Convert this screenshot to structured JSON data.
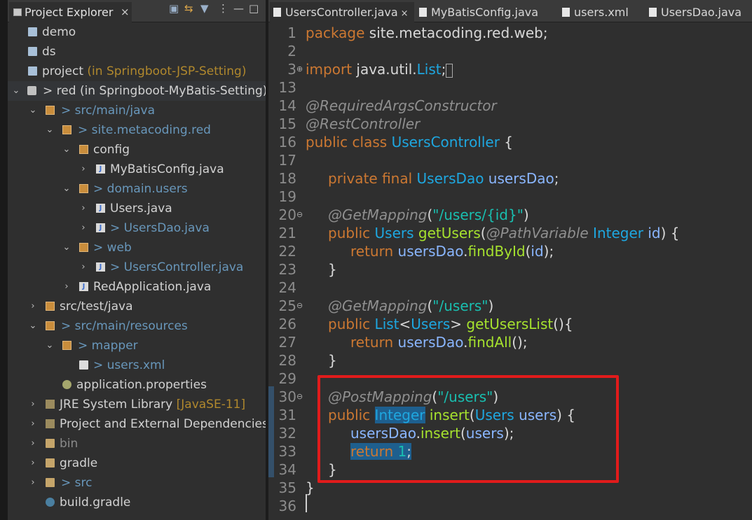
{
  "explorer": {
    "tab_label": "Project Explorer",
    "close": "×",
    "items": [
      {
        "label": "demo"
      },
      {
        "label": "ds"
      },
      {
        "label": "project",
        "suffix": "(in Springboot-JSP-Setting)"
      },
      {
        "prefix": ">",
        "label": "red",
        "suffix": "(in Springboot-MyBatis-Setting)"
      },
      {
        "prefix": ">",
        "label": "src/main/java"
      },
      {
        "prefix": ">",
        "label": "site.metacoding.red"
      },
      {
        "label": "config"
      },
      {
        "label": "MyBatisConfig.java"
      },
      {
        "prefix": ">",
        "label": "domain.users"
      },
      {
        "label": "Users.java"
      },
      {
        "prefix": ">",
        "label": "UsersDao.java"
      },
      {
        "prefix": ">",
        "label": "web"
      },
      {
        "prefix": ">",
        "label": "UsersController.java"
      },
      {
        "label": "RedApplication.java"
      },
      {
        "label": "src/test/java"
      },
      {
        "prefix": ">",
        "label": "src/main/resources"
      },
      {
        "prefix": ">",
        "label": "mapper"
      },
      {
        "prefix": ">",
        "label": "users.xml"
      },
      {
        "label": "application.properties"
      },
      {
        "label": "JRE System Library",
        "suffix": "[JavaSE-11]"
      },
      {
        "label": "Project and External Dependencies"
      },
      {
        "label": "bin"
      },
      {
        "label": "gradle"
      },
      {
        "prefix": ">",
        "label": "src"
      },
      {
        "label": "build.gradle"
      }
    ]
  },
  "editor": {
    "tabs": [
      {
        "label": "UsersController.java",
        "close": "×"
      },
      {
        "label": "MyBatisConfig.java"
      },
      {
        "label": "users.xml"
      },
      {
        "label": "UsersDao.java"
      }
    ],
    "lines": [
      {
        "n": "1",
        "text": "package site.metacoding.red.web;"
      },
      {
        "n": "2",
        "text": ""
      },
      {
        "n": "3",
        "text": "import java.util.List;"
      },
      {
        "n": "13",
        "text": ""
      },
      {
        "n": "14",
        "text": "@RequiredArgsConstructor"
      },
      {
        "n": "15",
        "text": "@RestController"
      },
      {
        "n": "16",
        "text": "public class UsersController {"
      },
      {
        "n": "17",
        "text": ""
      },
      {
        "n": "18",
        "text": "private final UsersDao usersDao;"
      },
      {
        "n": "19",
        "text": ""
      },
      {
        "n": "20",
        "text": "@GetMapping(\"/users/{id}\")"
      },
      {
        "n": "21",
        "text": "public Users getUsers(@PathVariable Integer id) {"
      },
      {
        "n": "22",
        "text": "return usersDao.findById(id);"
      },
      {
        "n": "23",
        "text": "}"
      },
      {
        "n": "24",
        "text": ""
      },
      {
        "n": "25",
        "text": "@GetMapping(\"/users\")"
      },
      {
        "n": "26",
        "text": "public List<Users> getUsersList(){"
      },
      {
        "n": "27",
        "text": "return usersDao.findAll();"
      },
      {
        "n": "28",
        "text": "}"
      },
      {
        "n": "29",
        "text": ""
      },
      {
        "n": "30",
        "text": "@PostMapping(\"/users\")"
      },
      {
        "n": "31",
        "text": "public Integer insert(Users users) {"
      },
      {
        "n": "32",
        "text": "usersDao.insert(users);"
      },
      {
        "n": "33",
        "text": "return 1;"
      },
      {
        "n": "34",
        "text": "}"
      },
      {
        "n": "35",
        "text": "}"
      },
      {
        "n": "36",
        "text": ""
      }
    ]
  },
  "colors": {
    "highlight_box": "#e11b1b",
    "keyword": "#cc7832",
    "type": "#1ea7e0",
    "method": "#a6e22e",
    "string": "#19bfb0"
  },
  "icons": [
    "toolbar-collapse-icon",
    "toolbar-link-icon",
    "toolbar-filter-icon",
    "toolbar-menu-icon",
    "minimize-icon",
    "maximize-icon"
  ]
}
